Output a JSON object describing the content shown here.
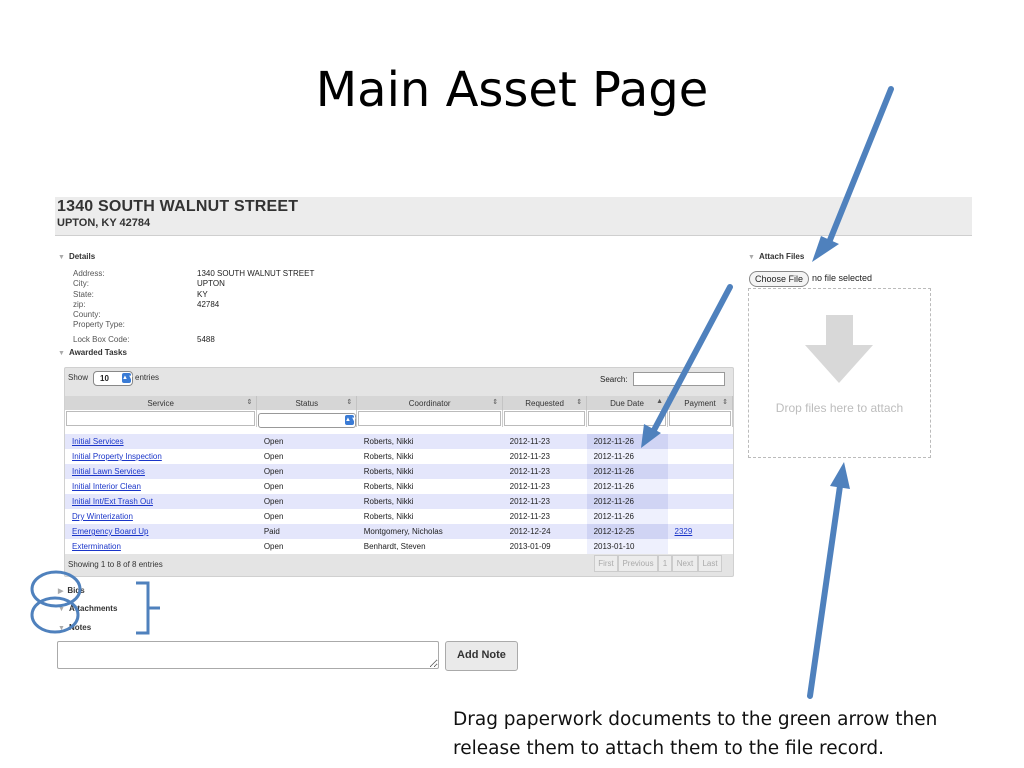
{
  "slide": {
    "title": "Main Asset Page",
    "caption_line1": "Drag paperwork documents to the green arrow then",
    "caption_line2": "release them to attach them to the file record."
  },
  "asset": {
    "address_line1": "1340 SOUTH WALNUT STREET",
    "address_line2": "UPTON, KY 42784"
  },
  "details": {
    "heading": "Details",
    "fields": [
      {
        "label": "Address:",
        "value": "1340 SOUTH WALNUT STREET"
      },
      {
        "label": "City:",
        "value": "UPTON"
      },
      {
        "label": "State:",
        "value": "KY"
      },
      {
        "label": "zip:",
        "value": "42784"
      },
      {
        "label": "County:",
        "value": ""
      },
      {
        "label": "Property Type:",
        "value": ""
      },
      {
        "label": "Lock Box Code:",
        "value": "5488"
      }
    ]
  },
  "awarded_tasks": {
    "heading": "Awarded Tasks",
    "show_prefix": "Show",
    "show_value": "10",
    "show_suffix": "entries",
    "search_label": "Search:",
    "columns": [
      "Service",
      "Status",
      "Coordinator",
      "Requested",
      "Due Date",
      "Payment"
    ],
    "rows": [
      {
        "service": "Initial Services",
        "status": "Open",
        "coordinator": "Roberts, Nikki",
        "requested": "2012-11-23",
        "due": "2012-11-26",
        "due_late": true,
        "payment": ""
      },
      {
        "service": "Initial Property Inspection",
        "status": "Open",
        "coordinator": "Roberts, Nikki",
        "requested": "2012-11-23",
        "due": "2012-11-26",
        "due_late": true,
        "payment": ""
      },
      {
        "service": "Initial Lawn Services",
        "status": "Open",
        "coordinator": "Roberts, Nikki",
        "requested": "2012-11-23",
        "due": "2012-11-26",
        "due_late": true,
        "payment": ""
      },
      {
        "service": "Initial Interior Clean",
        "status": "Open",
        "coordinator": "Roberts, Nikki",
        "requested": "2012-11-23",
        "due": "2012-11-26",
        "due_late": true,
        "payment": ""
      },
      {
        "service": "Initial Int/Ext Trash Out",
        "status": "Open",
        "coordinator": "Roberts, Nikki",
        "requested": "2012-11-23",
        "due": "2012-11-26",
        "due_late": true,
        "payment": ""
      },
      {
        "service": "Dry Winterization",
        "status": "Open",
        "coordinator": "Roberts, Nikki",
        "requested": "2012-11-23",
        "due": "2012-11-26",
        "due_late": true,
        "payment": ""
      },
      {
        "service": "Emergency Board Up",
        "status": "Paid",
        "coordinator": "Montgomery, Nicholas",
        "requested": "2012-12-24",
        "due": "2012-12-25",
        "due_late": false,
        "payment": "2329"
      },
      {
        "service": "Extermination",
        "status": "Open",
        "coordinator": "Benhardt, Steven",
        "requested": "2013-01-09",
        "due": "2013-01-10",
        "due_late": true,
        "payment": ""
      }
    ],
    "showing_text": "Showing 1 to 8 of 8 entries",
    "pager": {
      "first": "First",
      "previous": "Previous",
      "page": "1",
      "next": "Next",
      "last": "Last"
    }
  },
  "collapsed_sections": {
    "bids": "Bids",
    "attachments": "Attachments",
    "notes": "Notes"
  },
  "notes": {
    "add_button": "Add Note"
  },
  "attach": {
    "heading": "Attach Files",
    "choose_button": "Choose File",
    "no_file_text": "no file selected",
    "drop_text": "Drop files here to attach"
  },
  "colors": {
    "annotation_arrow": "#4f81bd",
    "late_due": "#e0001b",
    "link": "#1a35c9"
  }
}
